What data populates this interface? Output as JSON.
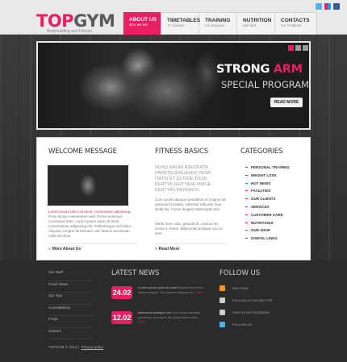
{
  "logo": {
    "part1": "TOP",
    "part2": "GYM",
    "tagline": "Bodybuilding and Fitness"
  },
  "nav": [
    {
      "label": "ABOUT US",
      "sub": "who we are"
    },
    {
      "label": "TIMETABLES",
      "sub": "17 classes"
    },
    {
      "label": "TRAINING",
      "sub": "our program"
    },
    {
      "label": "NUTRITION",
      "sub": "and diet"
    },
    {
      "label": "CONTACTS",
      "sub": "our locations"
    }
  ],
  "social_colors": {
    "twitter": "#4fb4e3",
    "flickr": "#e91e63",
    "facebook": "#3b5998"
  },
  "hero": {
    "title_white": "STRONG ",
    "title_pink": "ARM",
    "subtitle": "SPECIAL PROGRAM",
    "button": "READ MORE",
    "slides": 3,
    "active_slide": 1
  },
  "accent": "#e91e63",
  "welcome": {
    "title": "WELCOME MESSAGE",
    "text_lead": "Lorem ipsum dolor sit amet, consectetur adipiscing.",
    "text_body": "Proin dictum elementum velit. Fusce euismod consequat ante. Lorem ipsum dolor sit amet, consectetuer adipiscing elit. Pellentesque sed dolor. Aliquam congue fermentum nisl. Mauris accumsan nulla vel diam.",
    "more": "More About Us"
  },
  "fitness": {
    "title": "FITNESS BASICS",
    "caps": "NONU MAURI ASEDERTA PARNTEUENUASED PENA ITATIS ET QUISDE TOUR. BERTYA JERTYASE MIASE KERTYAS RADEROS.",
    "text1": "Cum sociis natoque penatibus et magnis dis parturient montes, nascetur ridiculus mus. Nulla dui. Fusce feugiat malesuada odio.",
    "text2": "Morbi nunc odio, gravida at, cursus nec, luctus a, lorem. Maecenas tristique orci ac sem.",
    "more": "Read More"
  },
  "categories": {
    "title": "CATEGORIES",
    "items": [
      "PERSONAL TRAINING",
      "WEIGHT LOSS",
      "HOT NEWS",
      "FACILITIES",
      "OUR CLIENTS",
      "SERVICES",
      "CUSTOMER CARE",
      "NUTRITIONS",
      "OUR SHOP",
      "USEFUL LINKS"
    ]
  },
  "footer_links": [
    "Our Staff",
    "Fresh News",
    "Our Tips",
    "Consultations",
    "FAQs",
    "Careers"
  ],
  "news": {
    "title": "LATEST NEWS",
    "items": [
      {
        "date": "24.02",
        "lead": "Lorem ipsum dolor sit amet",
        "text": "Mauris fermentum dictum magna. Sed laoreet aliquam leo.",
        "more": "more"
      },
      {
        "date": "12.02",
        "lead": "Maecenas tristique orci",
        "text": "Cum sociis natoque penatibus et magnis dis parturient montes.",
        "more": "more"
      }
    ]
  },
  "follow": {
    "title": "FOLLOW US",
    "items": [
      {
        "label": "RSS FEED",
        "color": "#f7941d"
      },
      {
        "label": "FOLLOW US ON TWITTER",
        "color": "#cccccc"
      },
      {
        "label": "JOIN US ON FACEBOOK",
        "color": "#cccccc"
      },
      {
        "label": "FOLLOW US",
        "color": "#4fb4e3"
      }
    ]
  },
  "copyright": {
    "text": "TOPGYM © 2012 |",
    "privacy": "Privacy policy"
  }
}
